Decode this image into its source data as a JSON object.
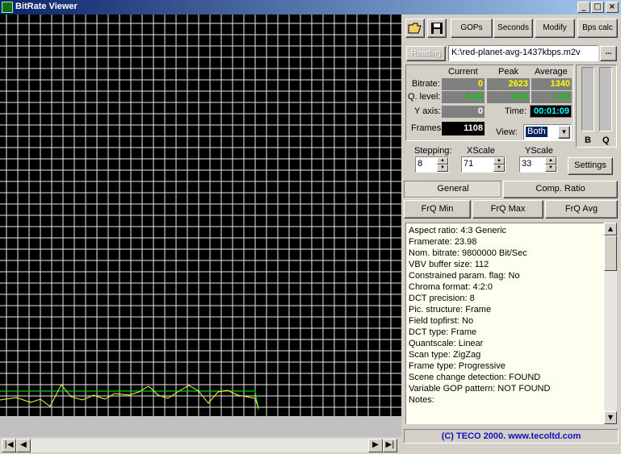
{
  "window": {
    "title": "BitRate Viewer"
  },
  "toolbar": {
    "gops": "GOPs",
    "seconds": "Seconds",
    "modify": "Modify",
    "bps_calc": "Bps calc"
  },
  "file": {
    "reading_label": "Reading",
    "path": "K:\\red-planet-avg-1437kbps.m2v",
    "browse": "..."
  },
  "stats": {
    "col_current": "Current",
    "col_peak": "Peak",
    "col_average": "Average",
    "bitrate_label": "Bitrate:",
    "bitrate_current": "0",
    "bitrate_peak": "2623",
    "bitrate_average": "1340",
    "qlevel_label": "Q. level:",
    "qlevel_current": "0.00",
    "qlevel_peak": "2.04",
    "qlevel_average": "1.92",
    "yaxis_label": "Y axis:",
    "yaxis_current": "0",
    "time_label": "Time:",
    "time_value": "00:01:09",
    "frames_label": "Frames:",
    "frames_value": "1108",
    "view_label": "View:",
    "view_value": "Both"
  },
  "meters": {
    "b_label": "B",
    "q_label": "Q"
  },
  "controls": {
    "stepping_label": "Stepping:",
    "stepping_value": "8",
    "xscale_label": "XScale",
    "xscale_value": "71",
    "yscale_label": "YScale",
    "yscale_value": "33",
    "settings": "Settings"
  },
  "tabs": {
    "general": "General",
    "comp_ratio": "Comp. Ratio"
  },
  "frq_buttons": {
    "min": "FrQ Min",
    "max": "FrQ Max",
    "avg": "FrQ Avg"
  },
  "info_lines": [
    "Aspect ratio: 4:3 Generic",
    "Framerate: 23.98",
    "Nom. bitrate: 9800000 Bit/Sec",
    "VBV buffer size: 112",
    "Constrained param. flag: No",
    "Chroma format: 4:2:0",
    "DCT precision: 8",
    "Pic. structure: Frame",
    "Field topfirst: No",
    "DCT type: Frame",
    "Quantscale: Linear",
    "Scan type: ZigZag",
    "Frame type: Progressive",
    "Scene change detection: FOUND",
    "Variable GOP pattern: NOT FOUND",
    "Notes:"
  ],
  "footer": "(C) TECO 2000. www.tecoltd.com",
  "colors": {
    "bitrate": "#ffff00",
    "qlevel": "#00cc00",
    "time": "#00ffff",
    "grid": "#ffffff",
    "footer": "#1010c0"
  }
}
